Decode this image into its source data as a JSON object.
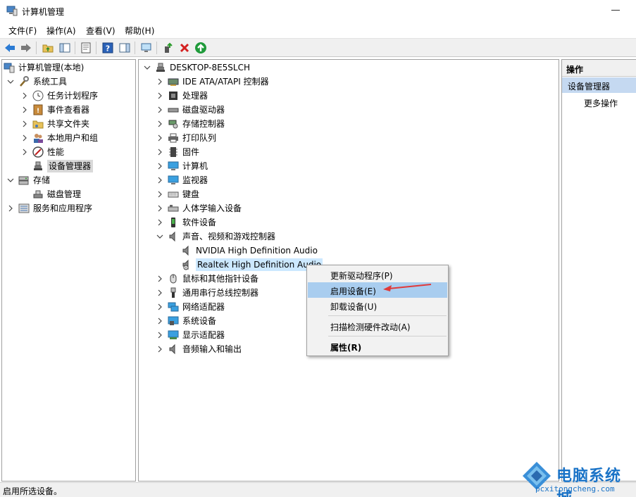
{
  "window": {
    "title": "计算机管理"
  },
  "menu": [
    "文件(F)",
    "操作(A)",
    "查看(V)",
    "帮助(H)"
  ],
  "left_tree": [
    {
      "label": "计算机管理(本地)",
      "icon": "computer-mgmt-icon",
      "expander": "collapsed-down",
      "level": 0
    },
    {
      "label": "系统工具",
      "icon": "tools-icon",
      "expander": "expanded",
      "level": 1
    },
    {
      "label": "任务计划程序",
      "icon": "clock-icon",
      "expander": "collapsed",
      "level": 2
    },
    {
      "label": "事件查看器",
      "icon": "event-viewer-icon",
      "expander": "collapsed",
      "level": 2
    },
    {
      "label": "共享文件夹",
      "icon": "shared-folder-icon",
      "expander": "collapsed",
      "level": 2
    },
    {
      "label": "本地用户和组",
      "icon": "users-icon",
      "expander": "collapsed",
      "level": 2
    },
    {
      "label": "性能",
      "icon": "performance-icon",
      "expander": "collapsed",
      "level": 2
    },
    {
      "label": "设备管理器",
      "icon": "device-manager-icon",
      "expander": "none",
      "level": 2,
      "selected": true
    },
    {
      "label": "存储",
      "icon": "storage-icon",
      "expander": "expanded",
      "level": 1
    },
    {
      "label": "磁盘管理",
      "icon": "disk-mgmt-icon",
      "expander": "none",
      "level": 2
    },
    {
      "label": "服务和应用程序",
      "icon": "services-icon",
      "expander": "collapsed",
      "level": 1
    }
  ],
  "device_tree": {
    "root": "DESKTOP-8E5SLCH",
    "items": [
      {
        "label": "IDE ATA/ATAPI 控制器",
        "icon": "ide-icon"
      },
      {
        "label": "处理器",
        "icon": "cpu-icon"
      },
      {
        "label": "磁盘驱动器",
        "icon": "disk-drive-icon"
      },
      {
        "label": "存储控制器",
        "icon": "storage-controller-icon"
      },
      {
        "label": "打印队列",
        "icon": "printer-icon"
      },
      {
        "label": "固件",
        "icon": "firmware-icon"
      },
      {
        "label": "计算机",
        "icon": "monitor-icon"
      },
      {
        "label": "监视器",
        "icon": "monitor-icon"
      },
      {
        "label": "键盘",
        "icon": "keyboard-icon"
      },
      {
        "label": "人体学输入设备",
        "icon": "hid-icon"
      },
      {
        "label": "软件设备",
        "icon": "software-device-icon"
      },
      {
        "label": "声音、视频和游戏控制器",
        "icon": "speaker-icon",
        "expanded": true
      },
      {
        "label": "NVIDIA High Definition Audio",
        "icon": "speaker-icon",
        "child": true
      },
      {
        "label": "Realtek High Definition Audio",
        "icon": "speaker-disabled-icon",
        "child": true,
        "selected": true
      },
      {
        "label": "鼠标和其他指针设备",
        "icon": "mouse-icon"
      },
      {
        "label": "通用串行总线控制器",
        "icon": "usb-icon"
      },
      {
        "label": "网络适配器",
        "icon": "network-icon"
      },
      {
        "label": "系统设备",
        "icon": "system-device-icon"
      },
      {
        "label": "显示适配器",
        "icon": "display-adapter-icon"
      },
      {
        "label": "音频输入和输出",
        "icon": "audio-io-icon"
      }
    ]
  },
  "actions": {
    "header": "操作",
    "section": "设备管理器",
    "more": "更多操作"
  },
  "context_menu": {
    "items": [
      "更新驱动程序(P)",
      "启用设备(E)",
      "卸载设备(U)",
      "扫描检测硬件改动(A)",
      "属性(R)"
    ],
    "highlighted_index": 1
  },
  "status": "启用所选设备。",
  "watermark": {
    "title": "电脑系统城",
    "url": "pcxitongcheng.com"
  },
  "colors": {
    "selection": "#a9cdef",
    "actions_section": "#c5d9f1",
    "arrow": "#e03a3a"
  }
}
